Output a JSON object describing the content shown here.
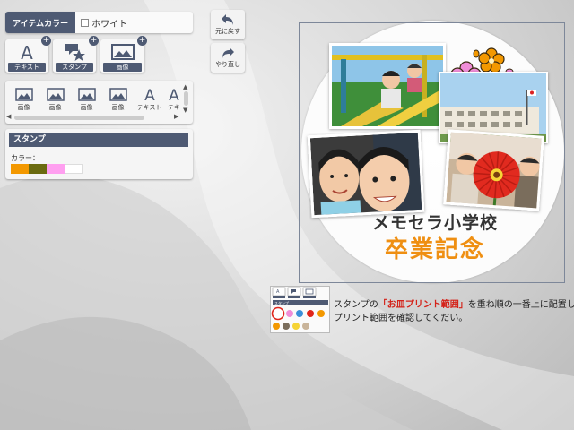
{
  "item_color": {
    "label": "アイテムカラー",
    "value": "ホワイト"
  },
  "add_buttons": [
    {
      "label": "テキスト",
      "icon": "text-add-icon"
    },
    {
      "label": "スタンプ",
      "icon": "stamp-add-icon"
    },
    {
      "label": "画像",
      "icon": "image-add-icon"
    }
  ],
  "history": {
    "undo_label": "元に戻す",
    "redo_label": "やり直し"
  },
  "item_list": [
    {
      "label": "画像",
      "icon": "image-icon"
    },
    {
      "label": "画像",
      "icon": "image-icon"
    },
    {
      "label": "画像",
      "icon": "image-icon"
    },
    {
      "label": "画像",
      "icon": "image-icon"
    },
    {
      "label": "テキスト",
      "icon": "text-icon"
    },
    {
      "label": "テキ",
      "icon": "text-icon"
    }
  ],
  "stamp_panel": {
    "title": "スタンプ",
    "color_label": "カラー：",
    "colors": [
      "#f39800",
      "#6b6b10",
      "#ff9ff0",
      "#ffffff"
    ]
  },
  "plate": {
    "title_line1": "メモセラ小学校",
    "title_line2": "卒業記念"
  },
  "tip": {
    "thumb_tabs": [
      "テキスト",
      "スタンプ",
      "画像"
    ],
    "thumb_header": "スタンプ",
    "pre": "スタンプの",
    "highlight": "「お皿プリント範囲」",
    "post": "を重ね順の一番上に配置し",
    "line2": "プリント範囲を確認してくだい。"
  }
}
